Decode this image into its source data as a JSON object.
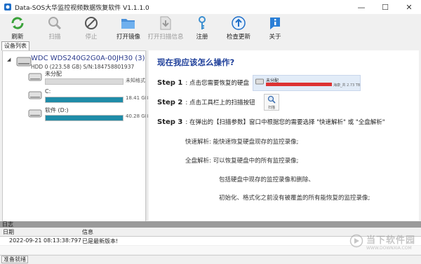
{
  "window": {
    "title": "Data-SOS大华监控视频数据恢复软件 V1.1.1.0",
    "controls": {
      "minimize": "—",
      "maximize": "☐",
      "close": "✕"
    }
  },
  "toolbar": [
    {
      "id": "refresh",
      "label": "刷新",
      "icon": "refresh-icon",
      "enabled": true
    },
    {
      "id": "scan",
      "label": "扫描",
      "icon": "magnifier-icon",
      "enabled": false
    },
    {
      "id": "stop",
      "label": "停止",
      "icon": "stop-icon",
      "enabled": false
    },
    {
      "id": "open-image",
      "label": "打开镜像",
      "icon": "folder-icon",
      "enabled": true
    },
    {
      "id": "open-scan-info",
      "label": "打开扫描信息",
      "icon": "download-file-icon",
      "enabled": false
    },
    {
      "id": "register",
      "label": "注册",
      "icon": "key-icon",
      "enabled": true
    },
    {
      "id": "check-update",
      "label": "检查更新",
      "icon": "arrow-up-circle-icon",
      "enabled": true
    },
    {
      "id": "about",
      "label": "关于",
      "icon": "info-icon",
      "enabled": true
    }
  ],
  "device_panel": {
    "tab_label": "设备列表",
    "disk": {
      "name": "WDC WDS240G2G0A-00JH30 (3)",
      "detail": "HDD 0 (223.58 GB) S/N:184758801937"
    },
    "partitions": [
      {
        "name": "未分配",
        "size": "未知格式",
        "fill": 0
      },
      {
        "name": "C:",
        "size": "18.41 GB",
        "fill": 1.0
      },
      {
        "name": "软件 (D:)",
        "size": "40.28 GB",
        "fill": 1.0
      }
    ]
  },
  "guide": {
    "title": "现在我应该怎么操作?",
    "step1_label": "Step 1",
    "step1_text": ": 点击您需要恢复的硬盘",
    "step1_disk_label": "未分配",
    "step1_disk_size": "海康_共 2.73 TB",
    "step2_label": "Step 2",
    "step2_text": ": 点击工具栏上的扫描按钮",
    "step2_button_label": "扫描",
    "step3_label": "Step 3",
    "step3_text": ": 在弹出的【扫描参数】窗口中根据您的需要选择 \"快速解析\" 或 \"全盘解析\"",
    "quick": "快速解析: 能快速恢复硬盘现存的监控录像;",
    "full": "全盘解析: 可以恢复硬盘中的所有监控录像;",
    "full_detail1": "包括硬盘中现存的监控录像和删除、",
    "full_detail2": "初始化、格式化之前没有被覆盖的所有能恢复的监控录像;"
  },
  "log": {
    "title": "日志",
    "col_date": "日期",
    "col_info": "信息",
    "rows": [
      {
        "date": "2022-09-21 08:13:38:797",
        "info": "已是最新版本!"
      }
    ]
  },
  "status": "准备就绪",
  "watermark": {
    "cn": "当下软件园",
    "en": "WWW.DOWNXIA.COM"
  },
  "colors": {
    "accent": "#1e3f9a",
    "bar_fill": "#1f8ca8",
    "disk_red": "#dd3333"
  }
}
